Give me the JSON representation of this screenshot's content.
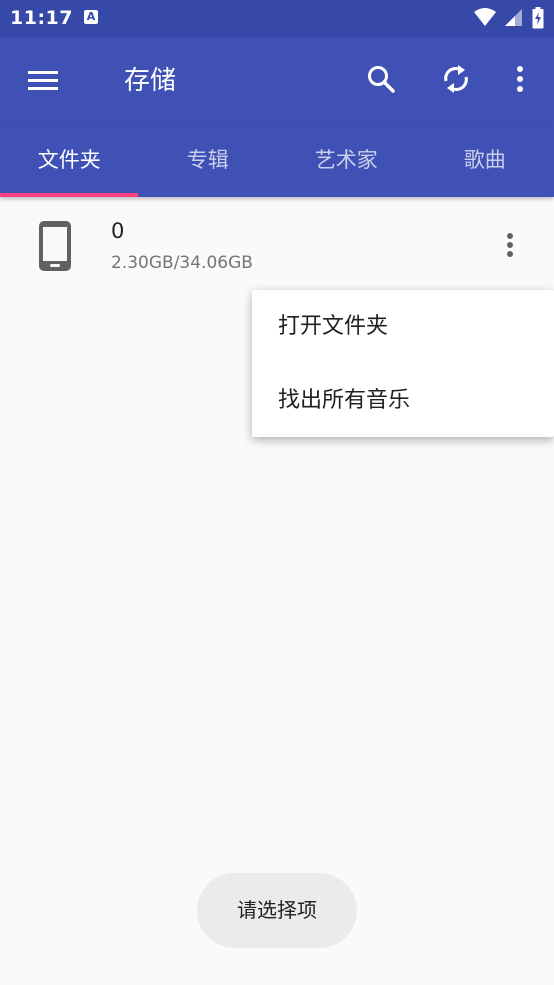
{
  "status_bar": {
    "time": "11:17",
    "notification_icon": "A"
  },
  "app_bar": {
    "title": "存储"
  },
  "tabs": [
    {
      "label": "文件夹",
      "active": true
    },
    {
      "label": "专辑",
      "active": false
    },
    {
      "label": "艺术家",
      "active": false
    },
    {
      "label": "歌曲",
      "active": false
    }
  ],
  "storage_item": {
    "name": "0",
    "usage": "2.30GB/34.06GB"
  },
  "popup_menu": {
    "items": [
      "打开文件夹",
      "找出所有音乐"
    ]
  },
  "toast": {
    "text": "请选择项"
  },
  "colors": {
    "primary": "#3f51b5",
    "status_bar": "#3749a8",
    "accent": "#ff4081"
  }
}
